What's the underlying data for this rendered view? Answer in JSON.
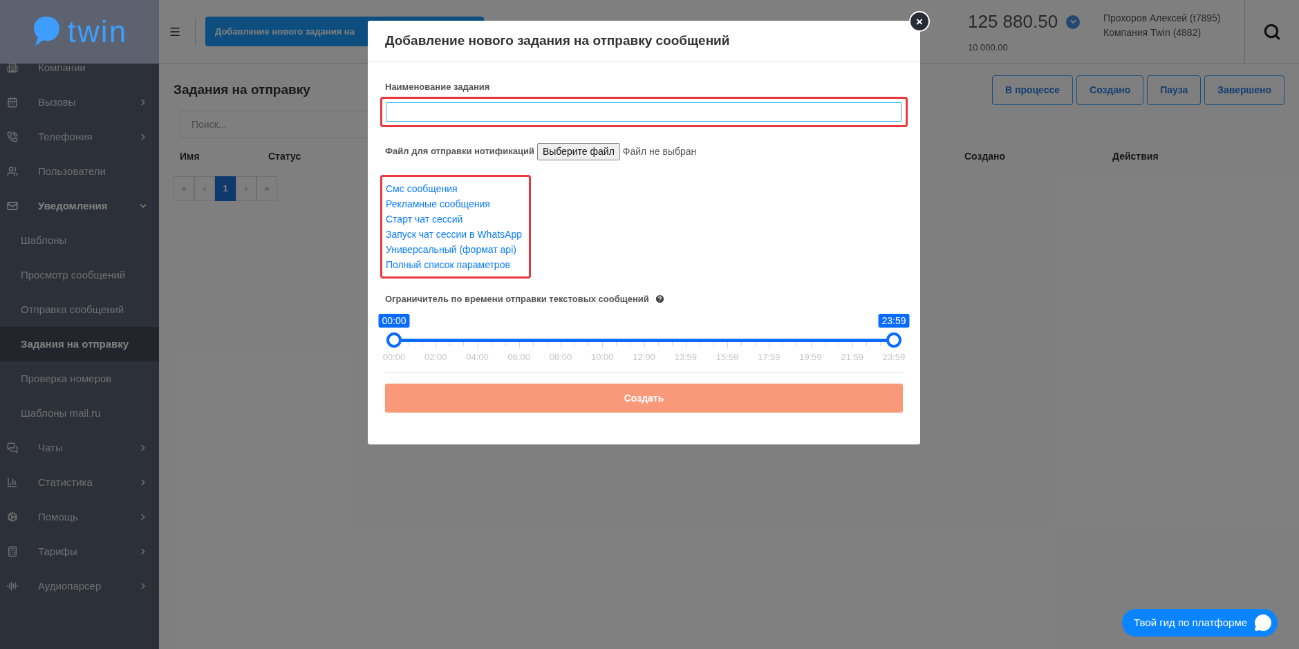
{
  "sidebar": {
    "logo": "twin",
    "items": [
      {
        "label": "Компании",
        "selected": false
      },
      {
        "label": "Вызовы",
        "selected": false,
        "expanded": false
      },
      {
        "label": "Телефония",
        "selected": false,
        "expanded": false
      },
      {
        "label": "Пользователи",
        "selected": false
      },
      {
        "label": "Уведомления",
        "selected": false,
        "expanded": true,
        "children": [
          {
            "label": "Шаблоны",
            "selected": false
          },
          {
            "label": "Просмотр сообщений",
            "selected": false
          },
          {
            "label": "Отправка сообщений",
            "selected": false
          },
          {
            "label": "Задания на отправку",
            "selected": true
          },
          {
            "label": "Проверка номеров",
            "selected": false
          },
          {
            "label": "Шаблоны mail.ru",
            "selected": false
          }
        ]
      },
      {
        "label": "Чаты",
        "selected": false,
        "expanded": false
      },
      {
        "label": "Статистика",
        "selected": false,
        "expanded": false
      },
      {
        "label": "Помощь",
        "selected": false,
        "expanded": false
      },
      {
        "label": "Тарифы",
        "selected": false,
        "expanded": false
      },
      {
        "label": "Аудиопарсер",
        "selected": false,
        "expanded": false
      }
    ]
  },
  "header": {
    "add_button": "Добавление нового задания на",
    "balance": "125 880.50",
    "credit": "10 000.00",
    "user": "Прохоров Алексей (t7895)",
    "company": "Компания Twin (4882)"
  },
  "page": {
    "title": "Задания на отправку",
    "filters": [
      "В процессе",
      "Создано",
      "Пауза",
      "Завершено"
    ],
    "search": {
      "placeholder": "Поиск..."
    },
    "table": {
      "columns": [
        "Имя",
        "Статус",
        "Создано",
        "Действия"
      ]
    },
    "pagination": [
      {
        "label": "«",
        "selected": false
      },
      {
        "label": "‹",
        "selected": false
      },
      {
        "label": "1",
        "selected": true
      },
      {
        "label": "›",
        "selected": false
      },
      {
        "label": "»",
        "selected": false
      }
    ]
  },
  "modal": {
    "title": "Добавление нового задания на отправку сообщений",
    "close": "×",
    "name_label": "Наименование задания",
    "file_label": "Файл для отправки нотификаций",
    "file_button": "Выберите файл",
    "file_status": "Файл не выбран",
    "links": [
      "Смс сообщения",
      "Рекламные сообщения",
      "Старт чат сессий",
      "Запуск чат сессии в WhatsApp",
      "Универсальный (формат api)",
      "Полный список параметров"
    ],
    "slider": {
      "label": "Ограничитель по времени отправки текстовых сообщений",
      "from": {
        "level": 0,
        "label": "00:00"
      },
      "to": {
        "level": 1,
        "label": "23:59"
      },
      "ticks": [
        "00:00",
        "02:00",
        "04:00",
        "06:00",
        "08:00",
        "10:00",
        "12:00",
        "13:59",
        "15:59",
        "17:59",
        "19:59",
        "21:59",
        "23:59"
      ]
    },
    "submit": "Создать"
  },
  "guide_button": "Твой гид по платформе"
}
